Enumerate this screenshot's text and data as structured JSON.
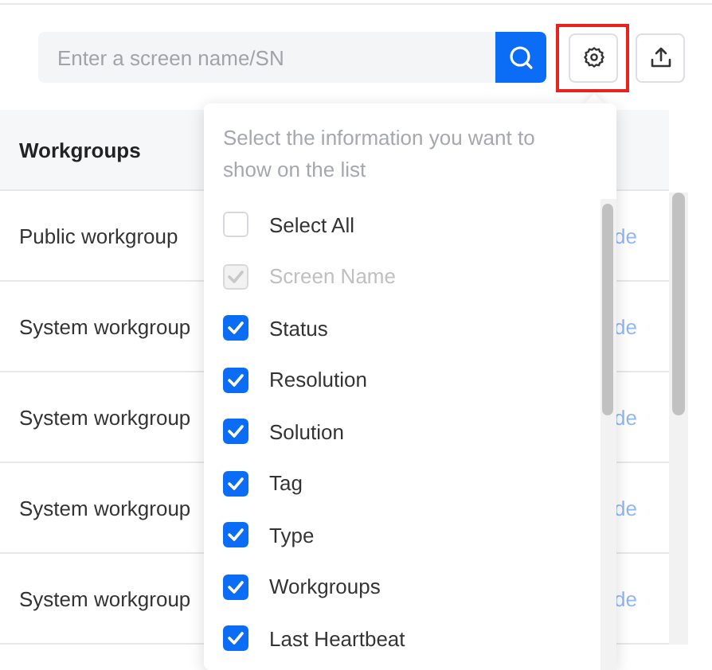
{
  "search": {
    "placeholder": "Enter a screen name/SN"
  },
  "table": {
    "columns": [
      "Workgroups"
    ],
    "rows": [
      {
        "workgroup": "Public workgroup",
        "column_2": "de"
      },
      {
        "workgroup": "System workgroup",
        "column_2": "de"
      },
      {
        "workgroup": "System workgroup",
        "column_2": "de"
      },
      {
        "workgroup": "System workgroup",
        "column_2": "de"
      },
      {
        "workgroup": "System workgroup",
        "column_2": "de"
      }
    ]
  },
  "column_menu": {
    "description": "Select the information you want to show on the list",
    "options": [
      {
        "label": "Select All",
        "checked": false,
        "disabled": false
      },
      {
        "label": "Screen Name",
        "checked": true,
        "disabled": true
      },
      {
        "label": "Status",
        "checked": true,
        "disabled": false
      },
      {
        "label": "Resolution",
        "checked": true,
        "disabled": false
      },
      {
        "label": "Solution",
        "checked": true,
        "disabled": false
      },
      {
        "label": "Tag",
        "checked": true,
        "disabled": false
      },
      {
        "label": "Type",
        "checked": true,
        "disabled": false
      },
      {
        "label": "Workgroups",
        "checked": true,
        "disabled": false
      },
      {
        "label": "Last Heartbeat",
        "checked": true,
        "disabled": false
      }
    ]
  }
}
